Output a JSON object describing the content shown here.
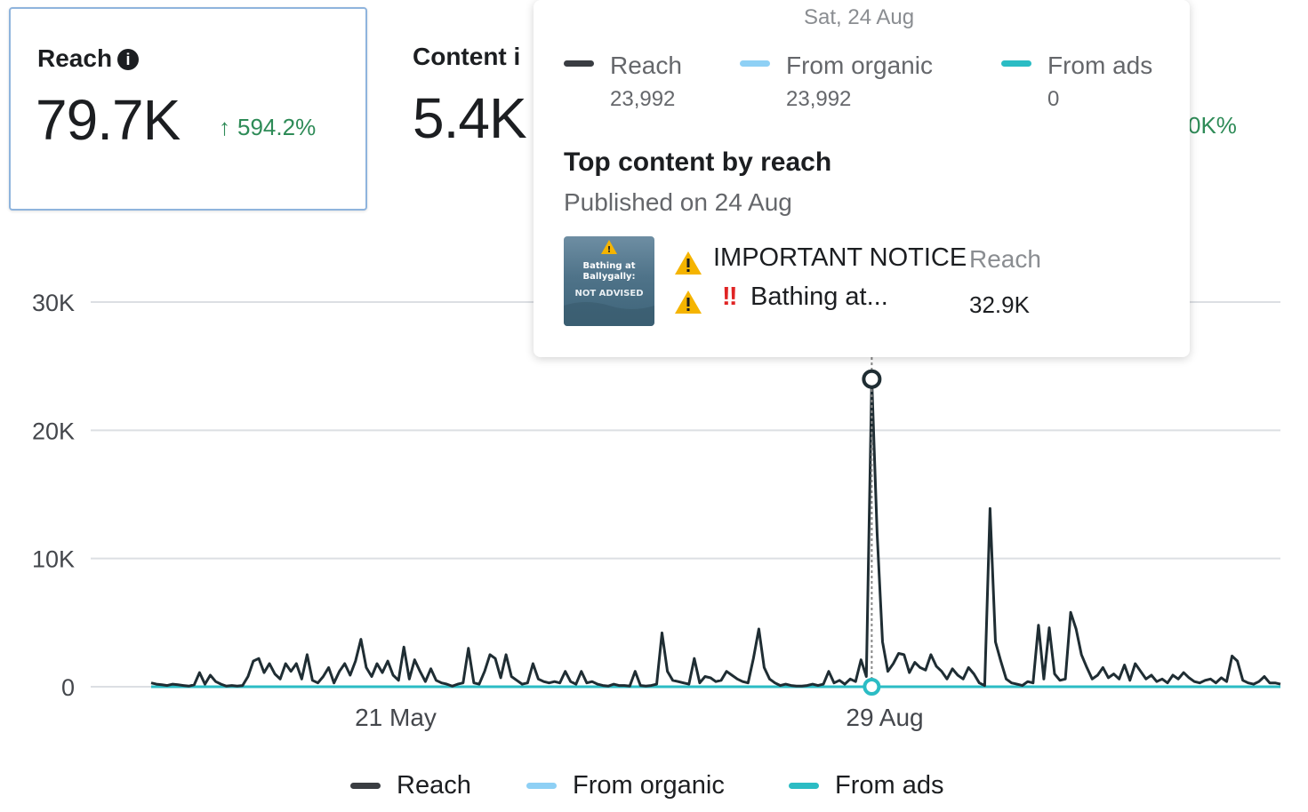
{
  "metrics": [
    {
      "title": "Reach",
      "value": "79.7K",
      "change": "594.2%"
    },
    {
      "title": "Content i",
      "value": "5.4K"
    }
  ],
  "partial_change": "0K%",
  "tooltip": {
    "date": "Sat, 24 Aug",
    "series": [
      {
        "name": "Reach",
        "value": "23,992",
        "color": "#3a3d42"
      },
      {
        "name": "From organic",
        "value": "23,992",
        "color": "#8ed0f5"
      },
      {
        "name": "From ads",
        "value": "0",
        "color": "#2bbcc4"
      }
    ],
    "top_content_title": "Top content by reach",
    "published": "Published on 24 Aug",
    "post": {
      "line1": "IMPORTANT NOTICE",
      "line2_emoji": "‼",
      "line2": "Bathing at...",
      "reach_label": "Reach",
      "reach_value": "32.9K",
      "thumbnail_text": [
        "Bathing at",
        "Ballygally:",
        "NOT ADVISED"
      ]
    }
  },
  "legend": [
    {
      "label": "Reach",
      "color": "#3a3d42"
    },
    {
      "label": "From organic",
      "color": "#8ed0f5"
    },
    {
      "label": "From ads",
      "color": "#2bbcc4"
    }
  ],
  "chart_data": {
    "type": "line",
    "y_ticks": [
      "30K",
      "20K",
      "10K",
      "0"
    ],
    "x_ticks": [
      "21 May",
      "29 Aug"
    ],
    "ylim": [
      0,
      30000
    ],
    "series": [
      {
        "name": "Reach",
        "color": "#1f2d33",
        "values": [
          300,
          200,
          150,
          100,
          200,
          150,
          100,
          50,
          150,
          1100,
          200,
          900,
          400,
          200,
          50,
          100,
          50,
          100,
          800,
          2000,
          2200,
          1100,
          1800,
          1000,
          600,
          1800,
          1200,
          1800,
          600,
          2500,
          500,
          300,
          800,
          1500,
          300,
          1200,
          1800,
          900,
          2000,
          3700,
          1500,
          800,
          1800,
          1100,
          2000,
          900,
          500,
          3100,
          600,
          2100,
          1200,
          400,
          1400,
          500,
          300,
          200,
          50,
          200,
          300,
          3000,
          300,
          200,
          1200,
          2500,
          2200,
          700,
          2500,
          800,
          500,
          200,
          300,
          1800,
          600,
          400,
          300,
          400,
          300,
          1200,
          400,
          200,
          1200,
          300,
          400,
          200,
          100,
          50,
          200,
          100,
          100,
          50,
          1200,
          100,
          50,
          100,
          200,
          4200,
          1200,
          500,
          400,
          300,
          200,
          2200,
          300,
          800,
          700,
          400,
          500,
          1200,
          900,
          600,
          400,
          300,
          2200,
          4500,
          1500,
          600,
          300,
          100,
          200,
          100,
          50,
          50,
          100,
          200,
          100,
          200,
          1200,
          300,
          500,
          200,
          600,
          400,
          2100,
          800,
          23992,
          12000,
          3500,
          1200,
          1800,
          2600,
          2500,
          1100,
          1900,
          1500,
          1300,
          2500,
          1600,
          1200,
          600,
          1400,
          900,
          600,
          1500,
          1000,
          300,
          100,
          13900,
          3500,
          2000,
          600,
          300,
          200,
          100,
          400,
          300,
          4800,
          600,
          4600,
          1000,
          500,
          600,
          5800,
          4500,
          2500,
          1500,
          600,
          900,
          1500,
          700,
          1000,
          600,
          1700,
          500,
          1800,
          1200,
          600,
          900,
          400,
          600,
          300,
          900,
          600,
          1100,
          700,
          400,
          300,
          500,
          600,
          300,
          700,
          400,
          2400,
          2000,
          500,
          300,
          200,
          400,
          800,
          300,
          300,
          200
        ]
      },
      {
        "name": "From ads",
        "color": "#2bbcc4",
        "values": "all 0"
      }
    ],
    "grid": true,
    "highlight_index_label": "Sat, 24 Aug"
  }
}
